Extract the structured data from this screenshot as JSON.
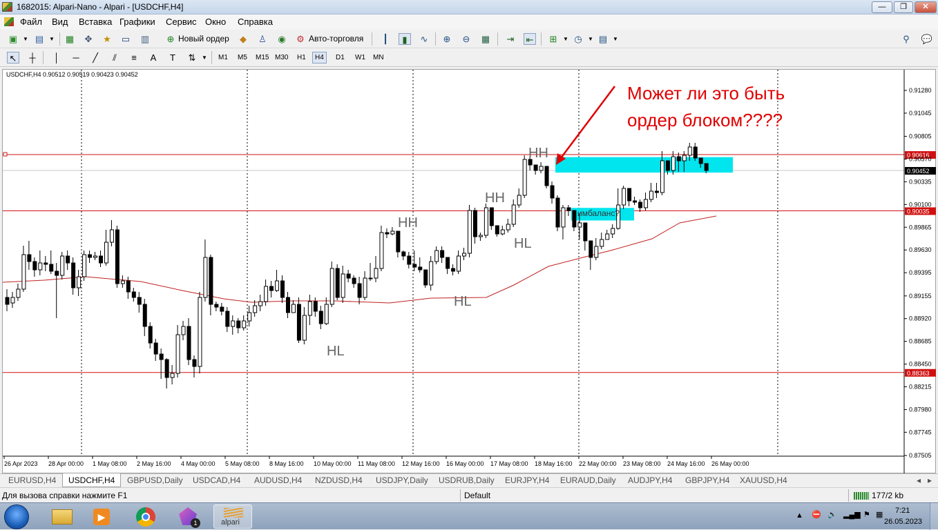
{
  "window": {
    "title": "1682015: Alpari-Nano - Alpari - [USDCHF,H4]",
    "minimize": "—",
    "maximize": "❐",
    "close": "✕"
  },
  "menu": [
    "Файл",
    "Вид",
    "Вставка",
    "Графики",
    "Сервис",
    "Окно",
    "Справка"
  ],
  "toolbar": {
    "new_order": "Новый ордер",
    "auto_trading": "Авто-торговля",
    "timeframes": [
      "M1",
      "M5",
      "M15",
      "M30",
      "H1",
      "H4",
      "D1",
      "W1",
      "MN"
    ],
    "active_timeframe": "H4"
  },
  "chart": {
    "header": "USDCHF,H4  0.90512 0.90519 0.90423 0.90452",
    "price_labels": [
      "0.91280",
      "0.91045",
      "0.90805",
      "0.90570",
      "0.90335",
      "0.90100",
      "0.89865",
      "0.89630",
      "0.89395",
      "0.89155",
      "0.88920",
      "0.88685",
      "0.88450",
      "0.88215",
      "0.87980",
      "0.87745",
      "0.87505"
    ],
    "level_tags": [
      {
        "value": "0.90616",
        "color": "#d01010"
      },
      {
        "value": "0.90452",
        "color": "#000000"
      },
      {
        "value": "0.90035",
        "color": "#d01010"
      },
      {
        "value": "0.88363",
        "color": "#d01010"
      }
    ],
    "time_labels": [
      "26 Apr 2023",
      "28 Apr 00:00",
      "1 May 08:00",
      "2 May 16:00",
      "4 May 00:00",
      "5 May 08:00",
      "8 May 16:00",
      "10 May 00:00",
      "11 May 08:00",
      "12 May 16:00",
      "16 May 00:00",
      "17 May 08:00",
      "18 May 16:00",
      "22 May 00:00",
      "23 May 08:00",
      "24 May 16:00",
      "26 May 00:00"
    ],
    "annotations": {
      "question_line1": "Может ли это быть",
      "question_line2": "ордер блоком????",
      "imbalance": "имбаланс?",
      "hh": "HH",
      "hl": "HL"
    },
    "colors": {
      "zone": "#00e5ee",
      "level": "#d01010",
      "ma": "#c02020",
      "candle": "#000000"
    }
  },
  "tabs": [
    "EURUSD,H4",
    "USDCHF,H4",
    "GBPUSD,Daily",
    "USDCAD,H4",
    "AUDUSD,H4",
    "NZDUSD,H4",
    "USDJPY,Daily",
    "USDRUB,Daily",
    "EURJPY,H4",
    "EURAUD,Daily",
    "AUDJPY,H4",
    "GBPJPY,H4",
    "XAUUSD,H4"
  ],
  "active_tab": "USDCHF,H4",
  "status": {
    "help": "Для вызова справки нажмите F1",
    "profile": "Default",
    "traffic": "177/2 kb"
  },
  "taskbar": {
    "apps": [
      "explorer-icon",
      "media-player-icon",
      "chrome-icon",
      "app-icon",
      "alpari-icon"
    ],
    "alpari_label": "alpari",
    "badge": "1",
    "time": "7:21",
    "date": "26.05.2023"
  }
}
